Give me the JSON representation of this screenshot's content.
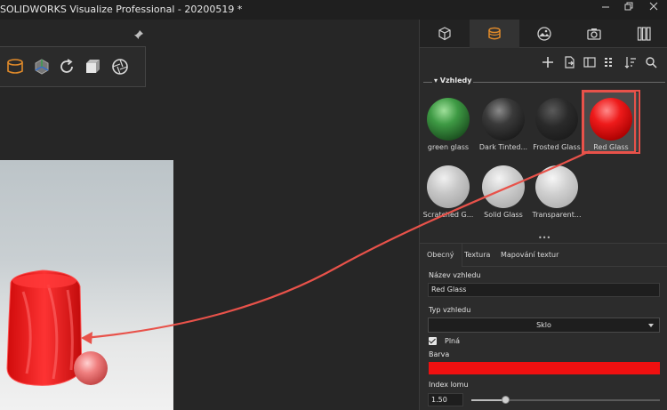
{
  "window": {
    "title": "SOLIDWORKS Visualize Professional - 20200519 *",
    "controls": [
      "minimize-icon",
      "restore-icon",
      "close-icon"
    ]
  },
  "viewport_toolbar": {
    "icons": [
      "appearance-bucket-icon",
      "scene-cube-icon",
      "refresh-icon",
      "export-cube-icon",
      "camera-shutter-icon"
    ],
    "pin": "pin-icon"
  },
  "panel": {
    "tabs": [
      {
        "id": "models",
        "icon": "cube-icon",
        "active": false
      },
      {
        "id": "appearances",
        "icon": "appearances-icon",
        "active": true
      },
      {
        "id": "scenes",
        "icon": "environment-icon",
        "active": false
      },
      {
        "id": "cameras",
        "icon": "camera-icon",
        "active": false
      },
      {
        "id": "libraries",
        "icon": "library-icon",
        "active": false
      }
    ],
    "actions": [
      "add-icon",
      "import-icon",
      "split-view-icon",
      "grid-view-icon",
      "sort-icon",
      "search-icon"
    ],
    "section_label": "▾ Vzhledy",
    "materials": [
      {
        "name": "green glass",
        "color": "#2f7d34"
      },
      {
        "name": "Dark Tinted...",
        "color": "#2a2a2a"
      },
      {
        "name": "Frosted Glass",
        "color": "#1e1e1e"
      },
      {
        "name": "Red Glass",
        "color": "#d01414",
        "selected": true
      },
      {
        "name": "Scratched G...",
        "color": "#bdbdbd"
      },
      {
        "name": "Solid Glass",
        "color": "#c4c4c4"
      },
      {
        "name": "Transparent...",
        "color": "#c8c8c8"
      }
    ],
    "splitter_grip": "•••"
  },
  "properties": {
    "tabs": [
      "Obecný",
      "Textura",
      "Mapování textur"
    ],
    "active_tab": "Obecný",
    "name_label": "Název vzhledu",
    "name_value": "Red Glass",
    "type_label": "Typ vzhledu",
    "type_value": "Sklo",
    "solid_label": "Plná",
    "solid_checked": true,
    "color_label": "Barva",
    "color_value": "#f01010",
    "ior_label": "Index lomu",
    "ior_value": "1.50",
    "ior_slider_fraction": 0.18
  },
  "annotation": {
    "arrow_color": "#e8524a",
    "highlight": "Red Glass"
  }
}
